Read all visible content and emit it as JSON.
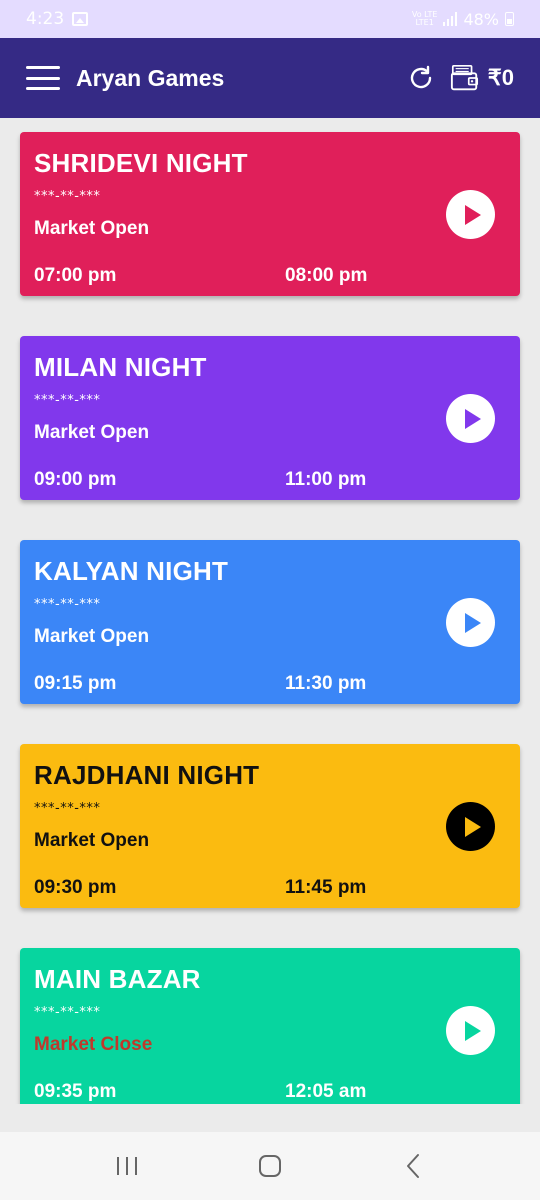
{
  "status_bar": {
    "time": "4:23",
    "network_label": "VoLTE LTE1",
    "battery": "48%",
    "icons": [
      "gallery-icon",
      "signal-icon",
      "battery-icon"
    ]
  },
  "app_bar": {
    "title": "Aryan Games",
    "wallet_amount": "₹0",
    "icons": [
      "menu-icon",
      "refresh-icon",
      "wallet-icon"
    ],
    "background": "#352a85"
  },
  "markets": [
    {
      "name": "SHRIDEVI NIGHT",
      "result": "***-**-***",
      "status": "Market Open",
      "open_time": "07:00 pm",
      "close_time": "08:00 pm",
      "color": "#e01f5a",
      "text_color": "#ffffff",
      "status_color": "#ffffff",
      "play_bg": "#ffffff",
      "play_fg": "#e01f5a"
    },
    {
      "name": "MILAN NIGHT",
      "result": "***-**-***",
      "status": "Market Open",
      "open_time": "09:00 pm",
      "close_time": "11:00 pm",
      "color": "#8138ec",
      "text_color": "#ffffff",
      "status_color": "#ffffff",
      "play_bg": "#ffffff",
      "play_fg": "#8138ec"
    },
    {
      "name": "KALYAN NIGHT",
      "result": "***-**-***",
      "status": "Market Open",
      "open_time": "09:15 pm",
      "close_time": "11:30 pm",
      "color": "#3b86f7",
      "text_color": "#ffffff",
      "status_color": "#ffffff",
      "play_bg": "#ffffff",
      "play_fg": "#3b86f7"
    },
    {
      "name": "RAJDHANI NIGHT",
      "result": "***-**-***",
      "status": "Market Open",
      "open_time": "09:30 pm",
      "close_time": "11:45 pm",
      "color": "#fbbb10",
      "text_color": "#111111",
      "status_color": "#111111",
      "play_bg": "#000000",
      "play_fg": "#fbbb10"
    },
    {
      "name": "MAIN BAZAR",
      "result": "***-**-***",
      "status": "Market Close",
      "open_time": "09:35 pm",
      "close_time": "12:05 am",
      "color": "#07d59f",
      "text_color": "#ffffff",
      "status_color": "#c0392b",
      "play_bg": "#ffffff",
      "play_fg": "#07d59f"
    }
  ],
  "nav_bar": {
    "icons": [
      "recent-apps-icon",
      "home-icon",
      "back-icon"
    ]
  }
}
